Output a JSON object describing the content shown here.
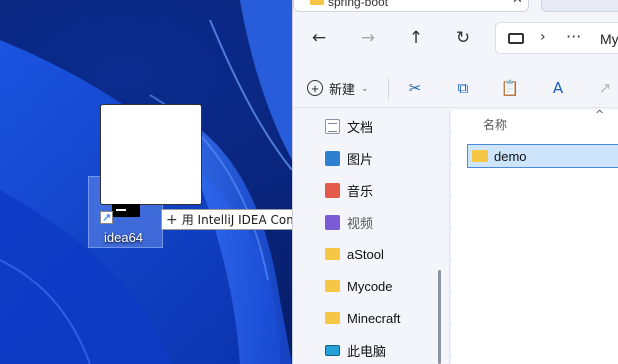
{
  "desktop": {
    "shortcut": {
      "label": "idea64",
      "arrow_glyph": "↗"
    },
    "drop_tooltip": {
      "plus": "+",
      "text": "用 IntelliJ IDEA Community Edition 打开"
    }
  },
  "explorer": {
    "tab": {
      "title": "spring-boot",
      "close": "✕"
    },
    "nav": {
      "back": "←",
      "forward": "→",
      "up": "↑",
      "refresh": "↻"
    },
    "address": {
      "chevron": "›",
      "more": "···",
      "segment": "Myc"
    },
    "toolbar": {
      "new_label": "新建",
      "new_plus": "+",
      "caret": "⌄",
      "cut": "✂",
      "copy": "⧉",
      "paste": "📋",
      "rename": "A",
      "share": "↗"
    },
    "quick_access": [
      {
        "label": "文档",
        "icon": "documents-icon"
      },
      {
        "label": "图片",
        "icon": "pictures-icon"
      },
      {
        "label": "音乐",
        "icon": "music-icon"
      },
      {
        "label": "视频",
        "icon": "videos-icon"
      },
      {
        "label": "aStool",
        "icon": "folder-icon"
      },
      {
        "label": "Mycode",
        "icon": "folder-icon"
      },
      {
        "label": "Minecraft",
        "icon": "folder-icon"
      },
      {
        "label": "此电脑",
        "icon": "this-pc-icon"
      }
    ],
    "pin_glyph": "📌",
    "content": {
      "column_header": "名称",
      "sort_caret": "^",
      "files": [
        {
          "name": "demo",
          "selected": true
        }
      ]
    }
  },
  "colors": {
    "wallpaper": "#0a2a8a",
    "wave": "#2f6cf0",
    "selection": "#cde4fb",
    "folder": "#f6c744"
  }
}
